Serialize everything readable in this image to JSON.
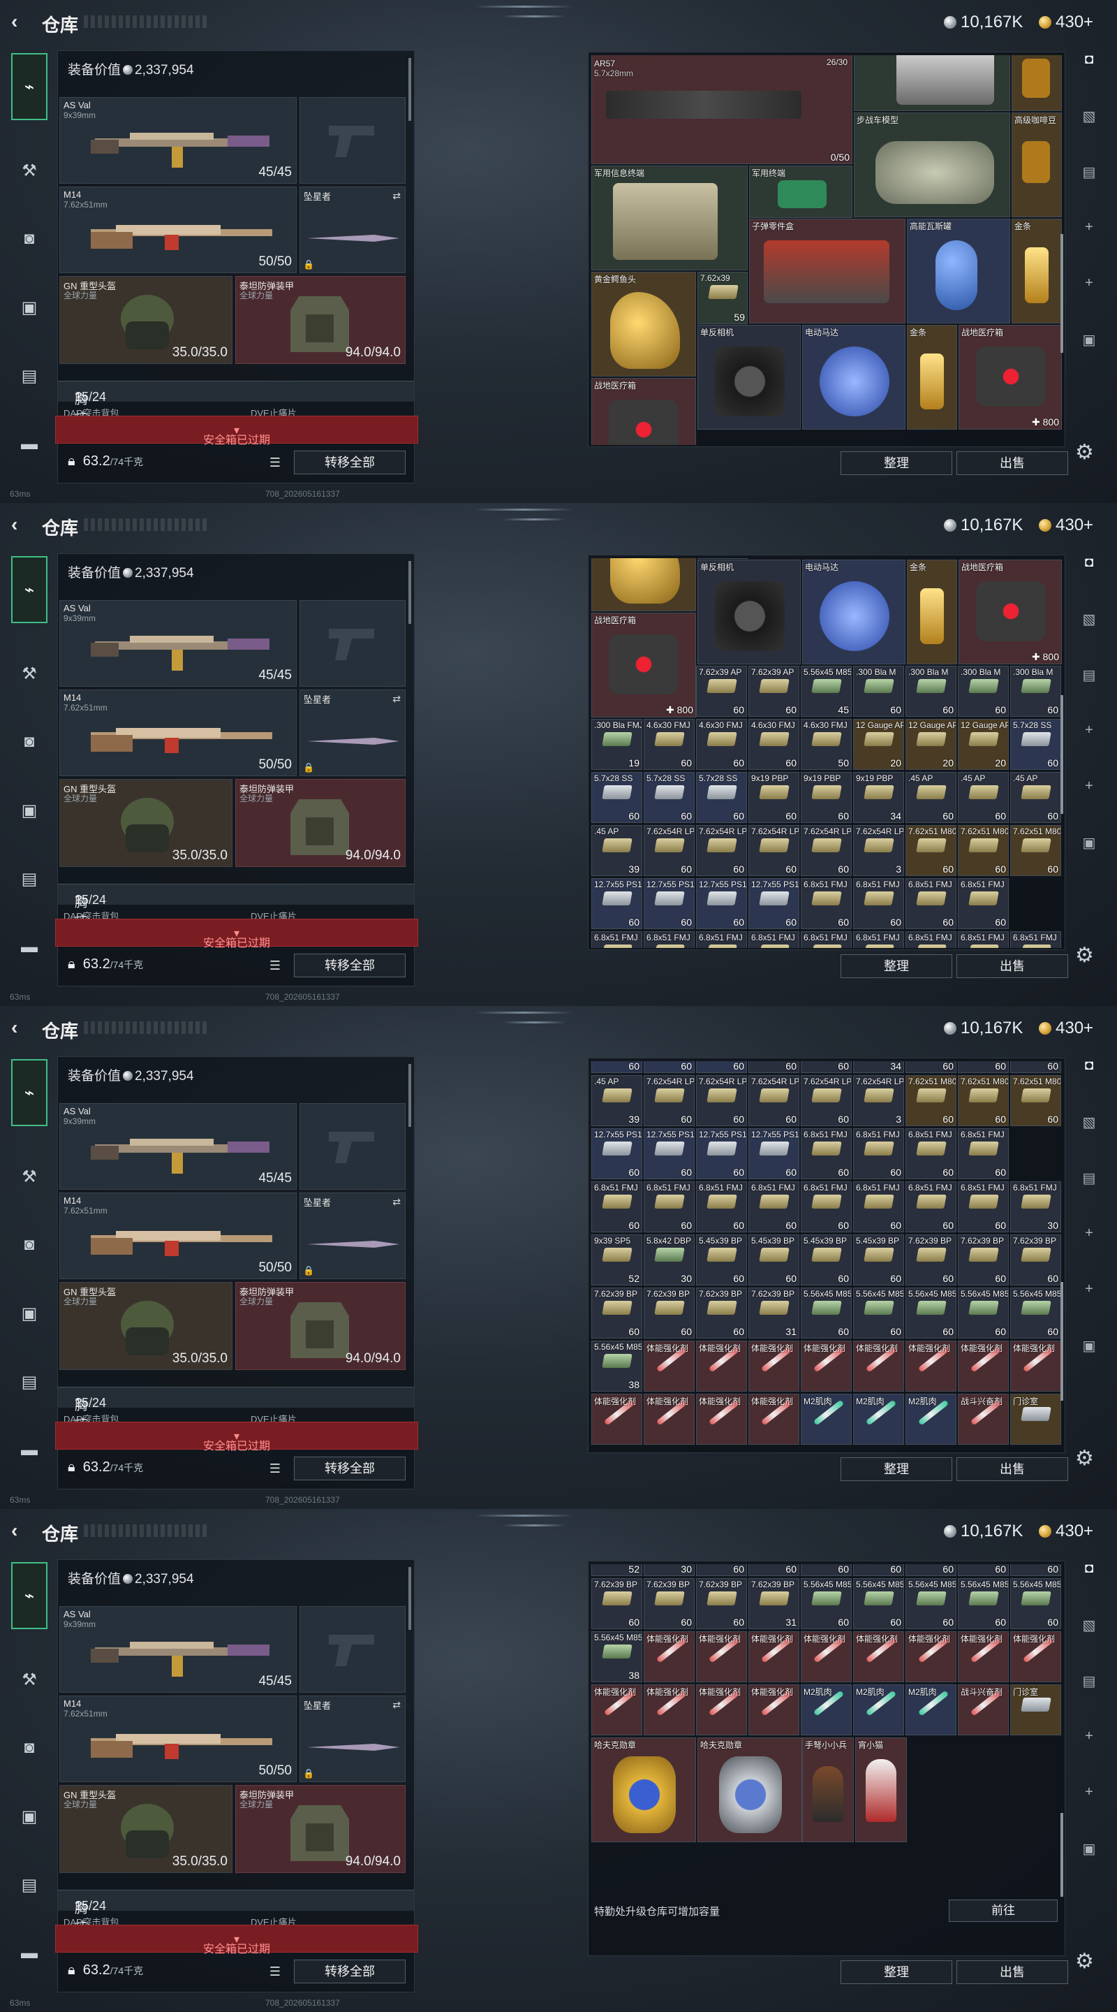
{
  "title": "仓库",
  "currency": {
    "silver": "10,167K",
    "gold": "430+"
  },
  "loadout": {
    "value_label": "装备价值",
    "value": "2,337,954",
    "primary": {
      "name": "AS Val",
      "ammo": "9x39mm",
      "dur": "45/45"
    },
    "secondary": {
      "name": "M14",
      "ammo": "7.62x51mm",
      "dur": "50/50"
    },
    "melee": {
      "name": "坠星者"
    },
    "helmet": {
      "name": "GN 重型头盔",
      "sub": "全球力量",
      "dur": "35.0/35.0"
    },
    "armor": {
      "name": "泰坦防弹装甲",
      "sub": "全球力量",
      "dur": "94.0/94.0"
    },
    "chest_label": "胸挂:",
    "chest_value": "15/24",
    "chest_help": "?",
    "sub1": "DAR突击背包",
    "sub2": "DVE止痛片",
    "expired": "安全箱已过期",
    "weight": "63.2",
    "weight_max": "/74千克",
    "transfer_all": "转移全部"
  },
  "footer": {
    "ping": "63ms",
    "build": "708_202605161337"
  },
  "buttons": {
    "sort": "整理",
    "sell": "出售",
    "goto": "前往"
  },
  "upgrade_hint": "特勤处升级仓库可增加容量",
  "items": {
    "ar57": {
      "name": "AR57",
      "sub": "5.7x28mm",
      "cap": "26/30",
      "dur": "0/50"
    },
    "ifv": "步战车模型",
    "coffee": "高级咖啡豆",
    "terminal": "军用信息终端",
    "chip": "军用终端",
    "parts": "子弹零件盒",
    "stove": "高能瓦斯罐",
    "goldbar": "金条",
    "horse": "黄金鳄鱼头",
    "ammo762x39": "7.62x39",
    "ammo762x39_qty": "59",
    "camera": "单反相机",
    "motor": "电动马达",
    "medkit": "战地医疗箱",
    "medkit_qty": "800",
    "badge": "哈夫克勋章",
    "fig1": "手弩小小兵",
    "fig2": "宵小猫"
  },
  "ammo_rows": [
    [
      [
        "7.62x39 AP",
        "60"
      ],
      [
        "7.62x39 AP",
        "60"
      ],
      [
        "5.56x45 M855",
        "45"
      ],
      [
        ".300 Bla M",
        "60"
      ],
      [
        ".300 Bla M",
        "60"
      ],
      [
        ".300 Bla M",
        "60"
      ],
      [
        ".300 Bla M",
        "60"
      ]
    ],
    [
      [
        ".300 Bla FMJ",
        "19"
      ],
      [
        "4.6x30 FMJ",
        "60"
      ],
      [
        "4.6x30 FMJ",
        "60"
      ],
      [
        "4.6x30 FMJ",
        "60"
      ],
      [
        "4.6x30 FMJ",
        "50"
      ],
      [
        "12 Gauge AP",
        "20"
      ],
      [
        "12 Gauge AP",
        "20"
      ],
      [
        "12 Gauge AP",
        "20"
      ],
      [
        "5.7x28 SS",
        "60"
      ]
    ],
    [
      [
        "5.7x28 SS",
        "60"
      ],
      [
        "5.7x28 SS",
        "60"
      ],
      [
        "5.7x28 SS",
        "60"
      ],
      [
        "9x19 PBP",
        "60"
      ],
      [
        "9x19 PBP",
        "60"
      ],
      [
        "9x19 PBP",
        "34"
      ],
      [
        ".45 AP",
        "60"
      ],
      [
        ".45 AP",
        "60"
      ],
      [
        ".45 AP",
        "60"
      ]
    ],
    [
      [
        ".45 AP",
        "39"
      ],
      [
        "7.62x54R LPS",
        "60"
      ],
      [
        "7.62x54R LPS",
        "60"
      ],
      [
        "7.62x54R LPS",
        "60"
      ],
      [
        "7.62x54R LPS",
        "60"
      ],
      [
        "7.62x54R LPS",
        "3"
      ],
      [
        "7.62x51 M80",
        "60"
      ],
      [
        "7.62x51 M80",
        "60"
      ],
      [
        "7.62x51 M80",
        "60"
      ]
    ],
    [
      [
        "12.7x55 PS12",
        "60"
      ],
      [
        "12.7x55 PS12",
        "60"
      ],
      [
        "12.7x55 PS12",
        "60"
      ],
      [
        "12.7x55 PS12",
        "60"
      ],
      [
        "6.8x51 FMJ",
        "60"
      ],
      [
        "6.8x51 FMJ",
        "60"
      ],
      [
        "6.8x51 FMJ",
        "60"
      ],
      [
        "6.8x51 FMJ",
        "60"
      ]
    ],
    [
      [
        "6.8x51 FMJ",
        "60"
      ],
      [
        "6.8x51 FMJ",
        "60"
      ],
      [
        "6.8x51 FMJ",
        "60"
      ],
      [
        "6.8x51 FMJ",
        "60"
      ],
      [
        "6.8x51 FMJ",
        "60"
      ],
      [
        "6.8x51 FMJ",
        "60"
      ],
      [
        "6.8x51 FMJ",
        "60"
      ],
      [
        "6.8x51 FMJ",
        "60"
      ],
      [
        "6.8x51 FMJ",
        "30"
      ]
    ],
    [
      [
        "9x39 SP5",
        "52"
      ],
      [
        "5.8x42 DBP",
        "30"
      ],
      [
        "5.45x39 BP",
        "60"
      ],
      [
        "5.45x39 BP",
        "60"
      ],
      [
        "5.45x39 BP",
        "60"
      ],
      [
        "5.45x39 BP",
        "60"
      ],
      [
        "7.62x39 BP",
        "60"
      ],
      [
        "7.62x39 BP",
        "60"
      ],
      [
        "7.62x39 BP",
        "60"
      ]
    ],
    [
      [
        "7.62x39 BP",
        "60"
      ],
      [
        "7.62x39 BP",
        "60"
      ],
      [
        "7.62x39 BP",
        "60"
      ],
      [
        "7.62x39 BP",
        "31"
      ],
      [
        "5.56x45 M855A1",
        "60"
      ],
      [
        "5.56x45 M855A1",
        "60"
      ],
      [
        "5.56x45 M855A1",
        "60"
      ],
      [
        "5.56x45 M855A1",
        "60"
      ],
      [
        "5.56x45 M855A1",
        "60"
      ]
    ],
    [
      [
        "5.56x45 M855A1",
        "38"
      ],
      [
        "体能强化剂",
        ""
      ],
      [
        "体能强化剂",
        ""
      ],
      [
        "体能强化剂",
        ""
      ],
      [
        "体能强化剂",
        ""
      ],
      [
        "体能强化剂",
        ""
      ],
      [
        "体能强化剂",
        ""
      ],
      [
        "体能强化剂",
        ""
      ],
      [
        "体能强化剂",
        ""
      ]
    ],
    [
      [
        "体能强化剂",
        ""
      ],
      [
        "体能强化剂",
        ""
      ],
      [
        "体能强化剂",
        ""
      ],
      [
        "体能强化剂",
        ""
      ],
      [
        "M2肌肉",
        ""
      ],
      [
        "M2肌肉",
        ""
      ],
      [
        "M2肌肉",
        ""
      ],
      [
        "战斗兴奋剂",
        ""
      ],
      [
        "门诊室",
        ""
      ]
    ]
  ],
  "nav_left": [
    "weapon-icon",
    "armor-icon",
    "backpack-icon",
    "lock-icon",
    "case-icon",
    "briefcase-icon"
  ],
  "colors": {
    "accent": "#3fbf86",
    "expired": "#7a1d22",
    "cell": "#2a2f3d"
  }
}
